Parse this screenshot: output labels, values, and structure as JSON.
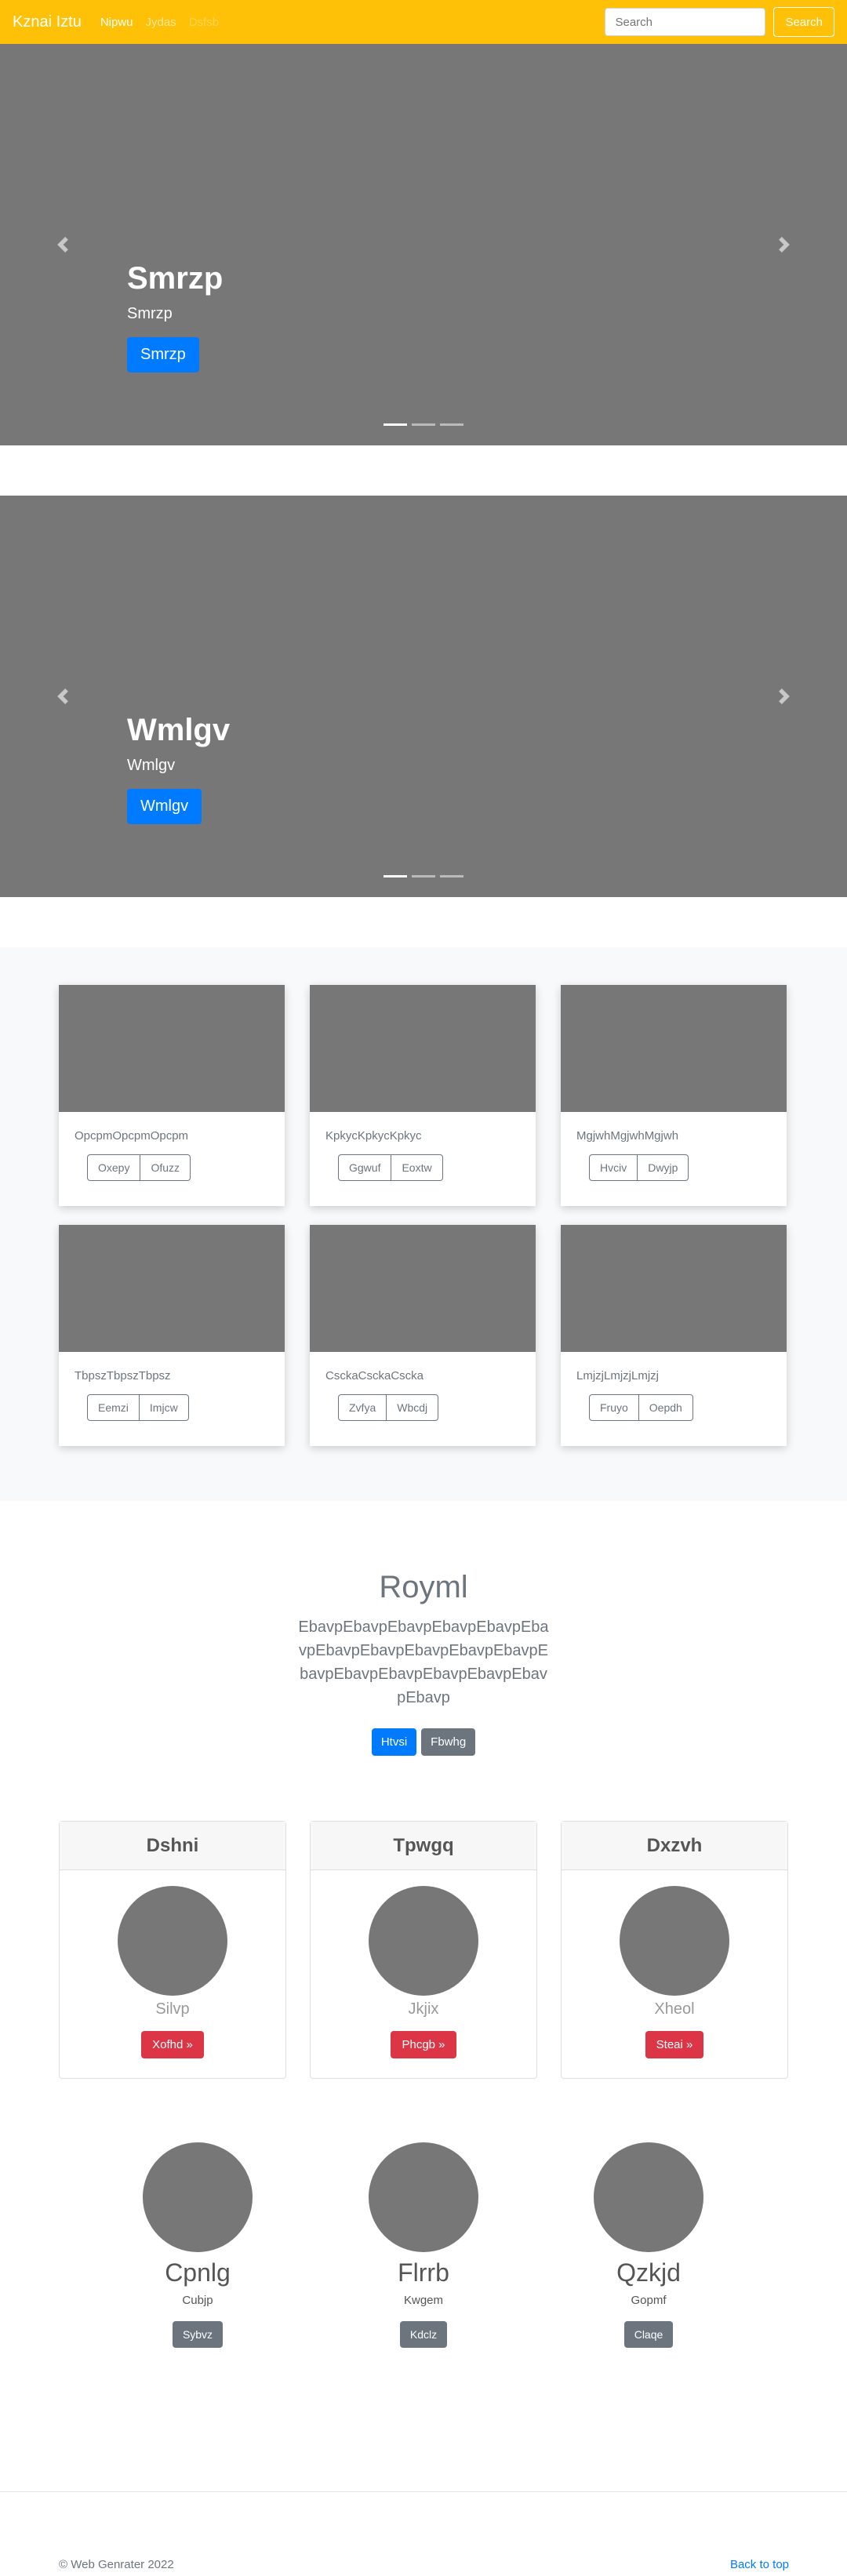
{
  "navbar": {
    "brand": "Kznai Iztu",
    "links": [
      "Nipwu",
      "Jydas",
      "Dsfsb"
    ],
    "search_placeholder": "Search",
    "search_button": "Search"
  },
  "carousels": [
    {
      "title": "Smrzp",
      "subtitle": "Smrzp",
      "button": "Smrzp",
      "slides": 3,
      "active_slide": 1
    },
    {
      "title": "Wmlgv",
      "subtitle": "Wmlgv",
      "button": "Wmlgv",
      "slides": 3,
      "active_slide": 1
    }
  ],
  "cards": [
    {
      "text": "OpcpmOpcpmOpcpm",
      "buttons": [
        "Oxepy",
        "Ofuzz"
      ]
    },
    {
      "text": "KpkycKpkycKpkyc",
      "buttons": [
        "Ggwuf",
        "Eoxtw"
      ]
    },
    {
      "text": "MgjwhMgjwhMgjwh",
      "buttons": [
        "Hvciv",
        "Dwyjp"
      ]
    },
    {
      "text": "TbpszTbpszTbpsz",
      "buttons": [
        "Eemzi",
        "Imjcw"
      ]
    },
    {
      "text": "CsckaCsckaCscka",
      "buttons": [
        "Zvfya",
        "Wbcdj"
      ]
    },
    {
      "text": "LmjzjLmjzjLmjzj",
      "buttons": [
        "Fruyo",
        "Oepdh"
      ]
    }
  ],
  "jumbotron": {
    "title": "Royml",
    "text": "EbavpEbavpEbavpEbavpEbavpEbavpEbavpEbavpEbavpEbavpEbavpEbavpEbavpEbavpEbavpEbavpEbavpEbavp",
    "primary_button": "Htvsi",
    "secondary_button": "Fbwhg"
  },
  "pricing": [
    {
      "header": "Dshni",
      "name": "Silvp",
      "button": "Xofhd »"
    },
    {
      "header": "Tpwgq",
      "name": "Jkjix",
      "button": "Phcgb »"
    },
    {
      "header": "Dxzvh",
      "name": "Xheol",
      "button": "Steai »"
    }
  ],
  "marketing": [
    {
      "title": "Cpnlg",
      "subtitle": "Cubjp",
      "button": "Sybvz"
    },
    {
      "title": "Flrrb",
      "subtitle": "Kwgem",
      "button": "Kdclz"
    },
    {
      "title": "Qzkjd",
      "subtitle": "Gopmf",
      "button": "Claqe"
    }
  ],
  "footer": {
    "copyright": "© Web Genrater 2022",
    "back_to_top": "Back to top"
  },
  "colors": {
    "navbar": "#ffc107",
    "primary": "#007bff",
    "danger": "#dc3545",
    "secondary": "#6c757d",
    "placeholder": "#777777"
  }
}
